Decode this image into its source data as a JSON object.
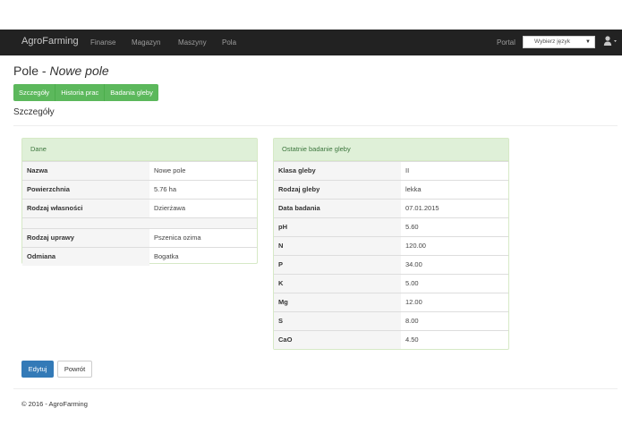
{
  "navbar": {
    "brand": "AgroFarming",
    "links": [
      "Finanse",
      "Magazyn",
      "Maszyny",
      "Pola"
    ],
    "portal": "Portal",
    "language_placeholder": "Wybierz język"
  },
  "page": {
    "title_prefix": "Pole - ",
    "title_name": "Nowe pole",
    "tabs": [
      "Szczegóły",
      "Historia prac",
      "Badania gleby"
    ],
    "section_title": "Szczegóły"
  },
  "left_panel": {
    "heading": "Dane",
    "rows": [
      {
        "key": "Nazwa",
        "value": "Nowe pole"
      },
      {
        "key": "Powierzchnia",
        "value": "5.76 ha"
      },
      {
        "key": "Rodzaj własności",
        "value": "Dzierżawa"
      },
      {
        "key": "Rodzaj uprawy",
        "value": "Pszenica ozima"
      },
      {
        "key": "Odmiana",
        "value": "Bogatka"
      }
    ]
  },
  "right_panel": {
    "heading": "Ostatnie badanie gleby",
    "rows": [
      {
        "key": "Klasa gleby",
        "value": "II"
      },
      {
        "key": "Rodzaj gleby",
        "value": "lekka"
      },
      {
        "key": "Data badania",
        "value": "07.01.2015"
      },
      {
        "key": "pH",
        "value": "5.60"
      },
      {
        "key": "N",
        "value": "120.00"
      },
      {
        "key": "P",
        "value": "34.00"
      },
      {
        "key": "K",
        "value": "5.00"
      },
      {
        "key": "Mg",
        "value": "12.00"
      },
      {
        "key": "S",
        "value": "8.00"
      },
      {
        "key": "CaO",
        "value": "4.50"
      }
    ]
  },
  "actions": {
    "edit": "Edytuj",
    "back": "Powrót"
  },
  "footer": "© 2016 - AgroFarming"
}
